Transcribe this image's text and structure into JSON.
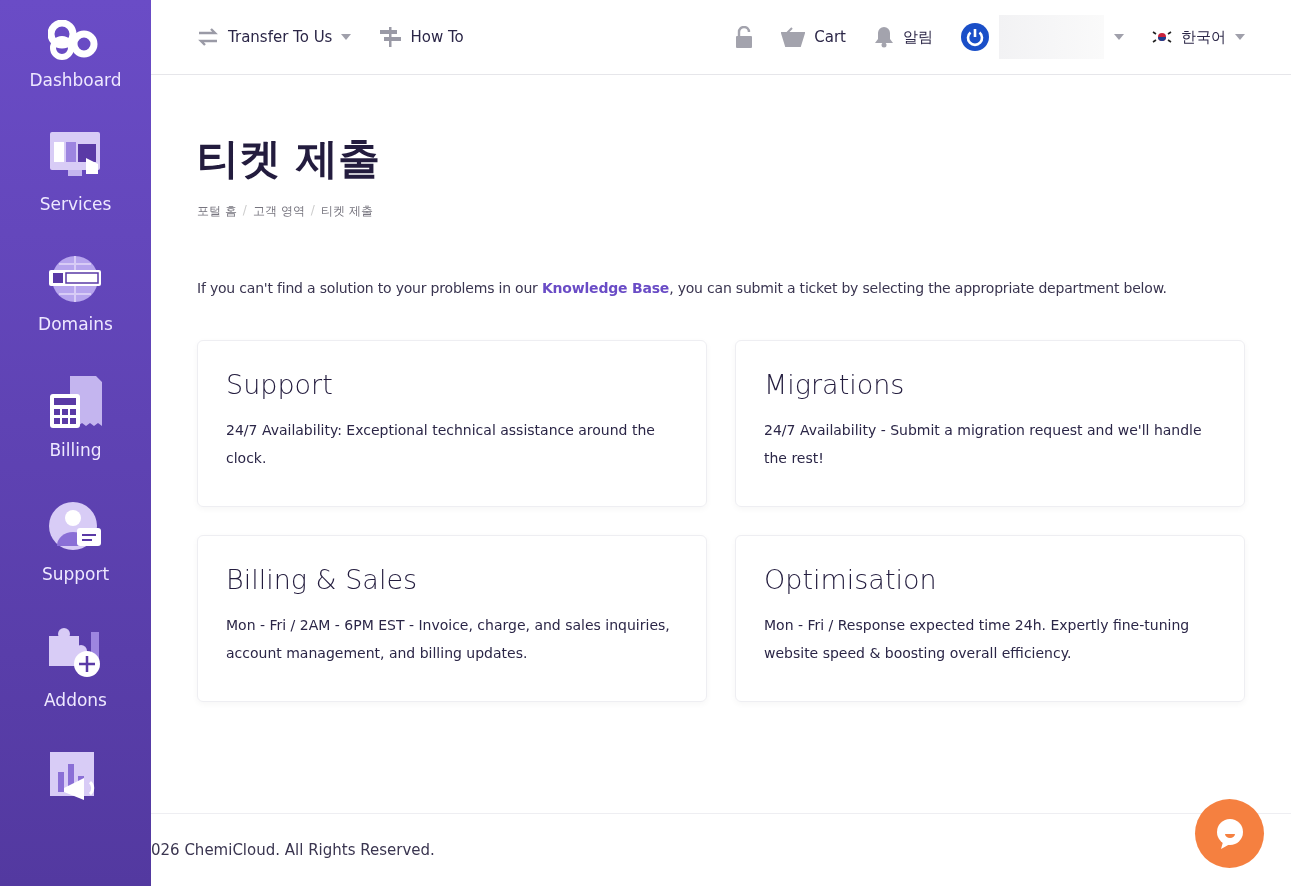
{
  "sidebar": {
    "items": [
      {
        "label": "Dashboard",
        "kind": "logo"
      },
      {
        "label": "Services",
        "kind": "services"
      },
      {
        "label": "Domains",
        "kind": "domains"
      },
      {
        "label": "Billing",
        "kind": "billing"
      },
      {
        "label": "Support",
        "kind": "support"
      },
      {
        "label": "Addons",
        "kind": "addons"
      },
      {
        "kind": "affiliates"
      }
    ]
  },
  "topbar": {
    "left": [
      {
        "label": "Transfer To Us",
        "kind": "transfer",
        "dropdown": true
      },
      {
        "label": "How To",
        "kind": "howto",
        "dropdown": false
      }
    ],
    "right": [
      {
        "kind": "lock"
      },
      {
        "label": "Cart",
        "kind": "cart"
      },
      {
        "label": "알림",
        "kind": "bell"
      }
    ],
    "language": "한국어"
  },
  "page": {
    "title": "티켓 제출",
    "breadcrumb": [
      "포털 홈",
      "고객 영역",
      "티켓 제출"
    ],
    "breadcrumb_separator": "/",
    "intro": "If you can't find a solution to your problems in our **Knowledge Base**, you can submit a ticket by selecting the appropriate department below.",
    "departments": [
      {
        "name": "Support",
        "description": "24/7 Availability: Exceptional technical assistance around the clock."
      },
      {
        "name": "Migrations",
        "description": "24/7 Availability - Submit a migration request and we'll handle the rest!"
      },
      {
        "name": "Billing & Sales",
        "description": "Mon - Fri / 2AM - 6PM EST - Invoice, charge, and sales inquiries, account management, and billing updates."
      },
      {
        "name": "Optimisation",
        "description": "Mon - Fri / Response expected time 24h. Expertly fine-tuning website speed & boosting overall efficiency."
      }
    ]
  },
  "footer": "026 ChemiCloud. All Rights Reserved."
}
